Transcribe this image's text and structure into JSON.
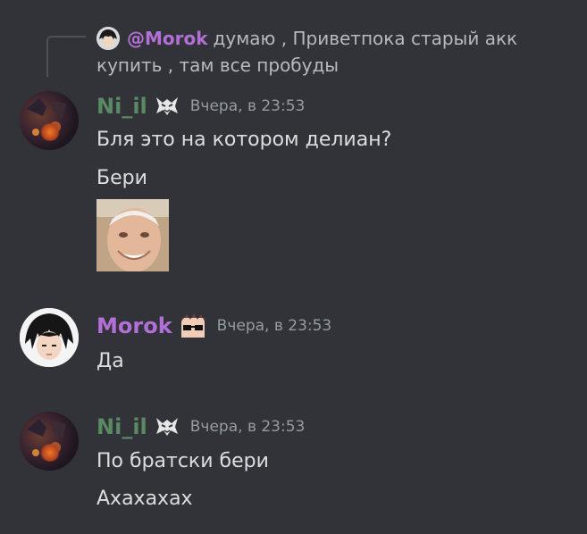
{
  "reply": {
    "author": "@Morok",
    "text": "думаю , Приветпока старый акк купить , там все пробуды"
  },
  "messages": [
    {
      "author": "Ni_il",
      "timestamp": "Вчера, в 23:53",
      "lines": [
        "Бля это на котором делиан?",
        "Бери"
      ],
      "sticker": "harold-meme-sticker"
    },
    {
      "author": "Morok",
      "timestamp": "Вчера, в 23:53",
      "lines": [
        "Да"
      ]
    },
    {
      "author": "Ni_il",
      "timestamp": "Вчера, в 23:53",
      "lines": [
        "По братски бери",
        "Ахахахах"
      ]
    }
  ],
  "colors": {
    "background": "#313338",
    "nil_name": "#5a8a63",
    "morok_name": "#b26fd6",
    "text": "#dbdee1",
    "muted": "#949ba4"
  }
}
